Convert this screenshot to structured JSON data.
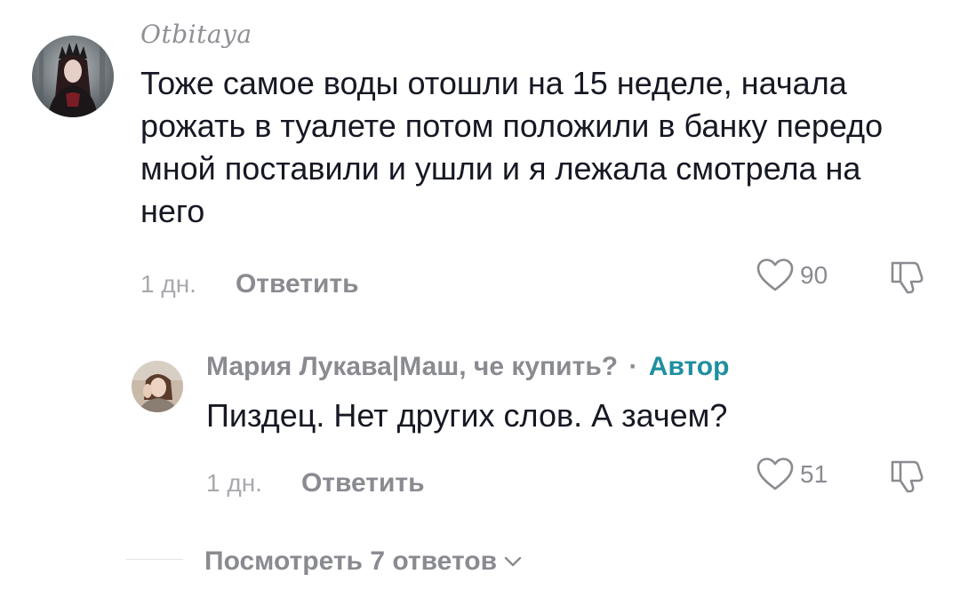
{
  "comment": {
    "username": "Otbitaya",
    "text": "Тоже самое воды отошли на 15 неделе, начала рожать в туалете потом положили в банку передо мной поставили и ушли и я лежала смотрела на него",
    "time": "1 дн.",
    "reply_label": "Ответить",
    "likes": "90",
    "avatar_icon": "avatar-gothic-woman"
  },
  "reply": {
    "username": "Мария Лукава|Маш, че купить?",
    "separator": "·",
    "author_tag": "Автор",
    "text": "Пиздец. Нет других слов. А зачем?",
    "time": "1 дн.",
    "reply_label": "Ответить",
    "likes": "51",
    "avatar_icon": "avatar-woman-portrait"
  },
  "view_replies": {
    "label": "Посмотреть 7 ответов",
    "icon": "chevron-down-icon"
  },
  "colors": {
    "text": "#161823",
    "muted": "#8a8b91",
    "author": "#1f8fa0"
  }
}
